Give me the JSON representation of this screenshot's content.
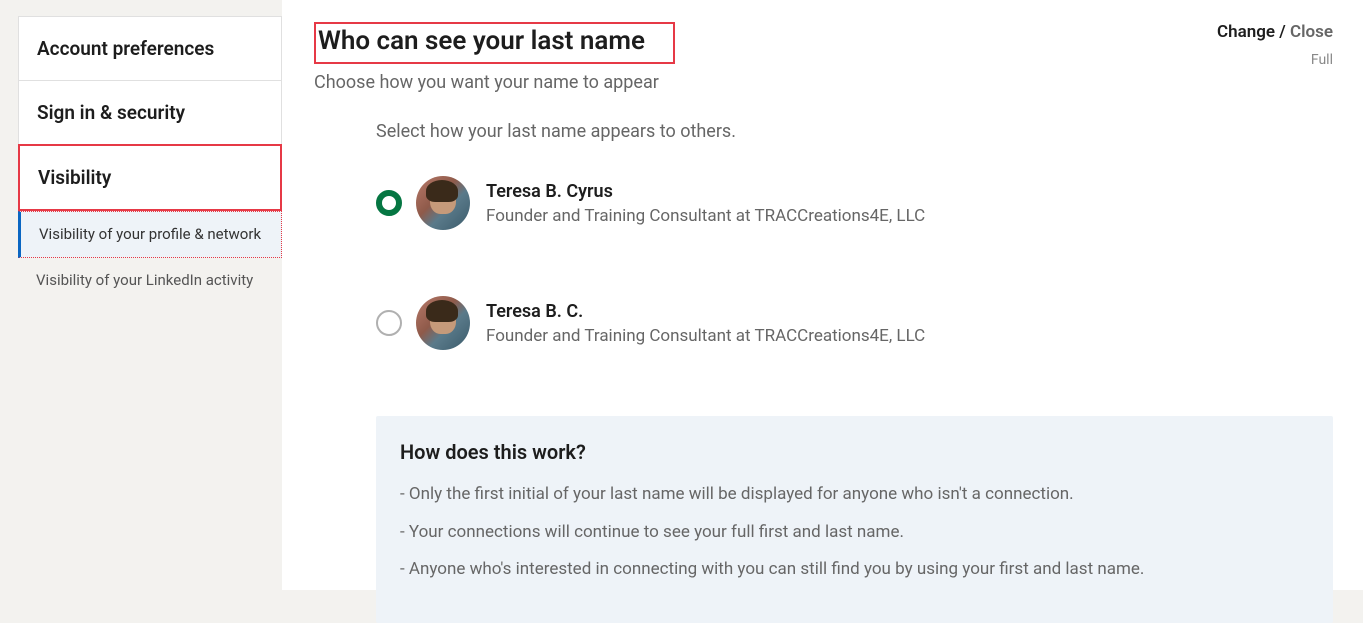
{
  "sidebar": {
    "main_items": [
      {
        "label": "Account preferences"
      },
      {
        "label": "Sign in & security"
      },
      {
        "label": "Visibility"
      }
    ],
    "sub_items": [
      {
        "label": "Visibility of your profile & network"
      },
      {
        "label": "Visibility of your LinkedIn activity"
      }
    ]
  },
  "header": {
    "title": "Who can see your last name",
    "subtitle": "Choose how you want your name to appear",
    "change_label": "Change",
    "slash": " / ",
    "close_label": "Close",
    "full_label": "Full"
  },
  "instruction": "Select how your last name appears to others.",
  "options": [
    {
      "name": "Teresa B. Cyrus",
      "desc": "Founder and Training Consultant at TRACCreations4E, LLC",
      "selected": true
    },
    {
      "name": "Teresa B. C.",
      "desc": "Founder and Training Consultant at TRACCreations4E, LLC",
      "selected": false
    }
  ],
  "info": {
    "title": "How does this work?",
    "lines": [
      "- Only the first initial of your last name will be displayed for anyone who isn't a connection.",
      "- Your connections will continue to see your full first and last name.",
      "- Anyone who's interested in connecting with you can still find you by using your first and last name."
    ]
  }
}
